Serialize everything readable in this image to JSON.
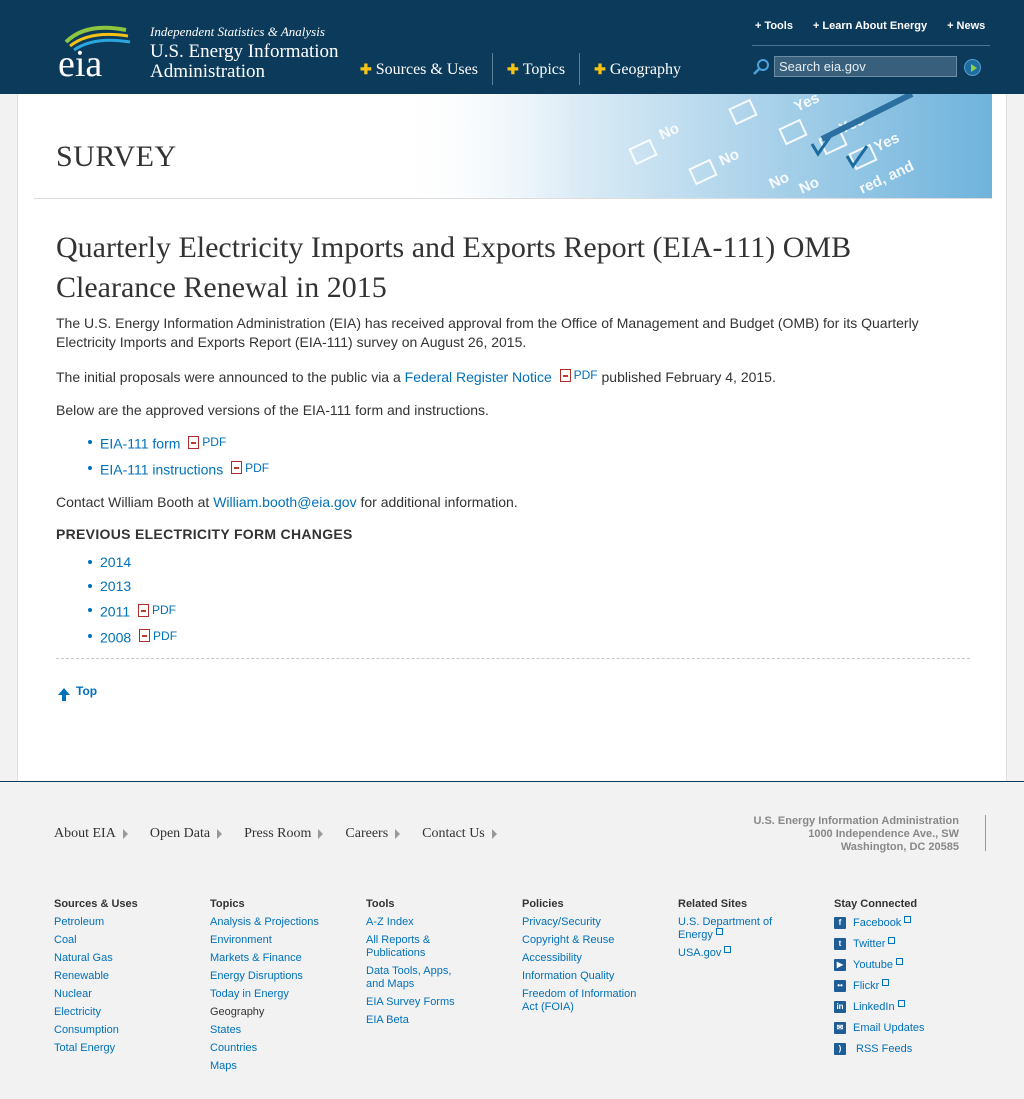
{
  "header": {
    "tagline": "Independent Statistics & Analysis",
    "org_name": "U.S. Energy Information Administration",
    "logo_text": "eia",
    "main_nav": [
      "Sources & Uses",
      "Topics",
      "Geography"
    ],
    "util_nav": [
      "Tools",
      "Learn About Energy",
      "News"
    ],
    "search_placeholder": "Search eia.gov"
  },
  "banner": {
    "title": "SURVEY",
    "art_words": [
      "No",
      "Yes",
      "No",
      "Yes",
      "No",
      "No",
      "Yes",
      "red, and"
    ]
  },
  "article": {
    "title": "Quarterly Electricity Imports and Exports Report (EIA-111) OMB Clearance Renewal in 2015",
    "p1": "The U.S. Energy Information Administration (EIA) has received approval from the Office of Management and Budget (OMB) for its Quarterly Electricity Imports and Exports Report (EIA-111) survey on August 26, 2015.",
    "p2_prefix": "The initial proposals were announced to the public via a",
    "p2_link": "Federal Register Notice",
    "p2_suffix": "published February 4, 2015.",
    "pdf_label": "PDF",
    "p3": "Below are the approved versions of the EIA-111 form and instructions.",
    "form_links": [
      "EIA-111 form",
      "EIA-111 instructions"
    ],
    "contact_prefix": "Contact William Booth at",
    "contact_email": "William.booth@eia.gov",
    "contact_suffix": "for additional information.",
    "prev_heading": "PREVIOUS ELECTRICITY FORM CHANGES",
    "prev_years": [
      "2014",
      "2013",
      "2011",
      "2008"
    ],
    "top_label": "Top"
  },
  "footer": {
    "nav": [
      "About EIA",
      "Open Data",
      "Press Room",
      "Careers",
      "Contact Us"
    ],
    "address": [
      "U.S. Energy Information Administration",
      "1000 Independence Ave., SW",
      "Washington, DC 20585"
    ],
    "columns": {
      "sources": {
        "heading": "Sources & Uses",
        "links": [
          "Petroleum",
          "Coal",
          "Natural Gas",
          "Renewable",
          "Nuclear",
          "Electricity",
          "Consumption",
          "Total Energy"
        ]
      },
      "topics": {
        "heading": "Topics",
        "links": [
          "Analysis & Projections",
          "Environment",
          "Markets & Finance",
          "Energy Disruptions",
          "Today in Energy"
        ],
        "geography_heading": "Geography",
        "geography_links": [
          "States",
          "Countries",
          "Maps"
        ]
      },
      "tools": {
        "heading": "Tools",
        "links": [
          "A-Z Index",
          "All Reports & Publications",
          "Data Tools, Apps, and Maps",
          "EIA Survey Forms",
          "EIA Beta"
        ]
      },
      "policies": {
        "heading": "Policies",
        "links": [
          "Privacy/Security",
          "Copyright & Reuse",
          "Accessibility",
          "Information Quality",
          "Freedom of Information Act (FOIA)"
        ]
      },
      "related": {
        "heading": "Related Sites",
        "links": [
          "U.S. Department of Energy",
          "USA.gov"
        ]
      },
      "connected": {
        "heading": "Stay Connected",
        "links": [
          "Facebook",
          "Twitter",
          "Youtube",
          "Flickr",
          "LinkedIn",
          "Email Updates",
          "RSS Feeds"
        ]
      }
    }
  }
}
